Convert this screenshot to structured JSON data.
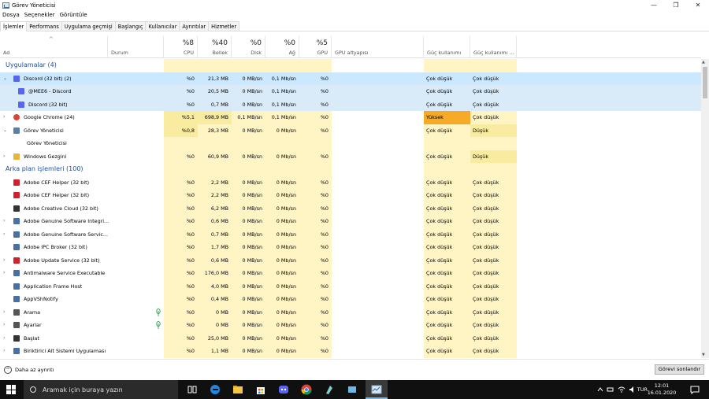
{
  "window": {
    "title": "Görev Yöneticisi",
    "buttons": {
      "minimize": "—",
      "maximize": "❐",
      "close": "✕"
    }
  },
  "menu": [
    "Dosya",
    "Seçenekler",
    "Görüntüle"
  ],
  "tabs": [
    "İşlemler",
    "Performans",
    "Uygulama geçmişi",
    "Başlangıç",
    "Kullanıcılar",
    "Ayrıntılar",
    "Hizmetler"
  ],
  "active_tab": 0,
  "columns": {
    "name": "Ad",
    "status": "Durum",
    "cpu": {
      "pct": "%8",
      "label": "CPU"
    },
    "memory": {
      "pct": "%40",
      "label": "Bellek"
    },
    "disk": {
      "pct": "%0",
      "label": "Disk"
    },
    "network": {
      "pct": "%0",
      "label": "Ağ"
    },
    "gpu": {
      "pct": "%5",
      "label": "GPU"
    },
    "gpu_engine": "GPU altyapısı",
    "power": "Güç kullanımı",
    "power_trend": "Güç kullanımı ..."
  },
  "rows": [
    {
      "type": "group",
      "title": "Uygulamalar (4)"
    },
    {
      "type": "proc",
      "expander": "⌄",
      "indent": 0,
      "icon": "discord-icon",
      "iconColor": "#5865f2",
      "name": "Discord (32 bit) (2)",
      "cpu": "%0",
      "mem": "21,3 MB",
      "disk": "0 MB/sn",
      "net": "0,1 Mb/sn",
      "gpu": "%0",
      "power": "Çok düşük",
      "trend": "Çok düşük",
      "sel": "selected"
    },
    {
      "type": "proc",
      "indent": 1,
      "icon": "discord-icon",
      "iconColor": "#5865f2",
      "name": "@MEE6 - Discord",
      "cpu": "%0",
      "mem": "20,5 MB",
      "disk": "0 MB/sn",
      "net": "0,1 Mb/sn",
      "gpu": "%0",
      "power": "Çok düşük",
      "trend": "Çok düşük",
      "sel": "selected-light"
    },
    {
      "type": "proc",
      "indent": 1,
      "icon": "discord-icon",
      "iconColor": "#5865f2",
      "name": "Discord (32 bit)",
      "cpu": "%0",
      "mem": "0,7 MB",
      "disk": "0 MB/sn",
      "net": "0,1 Mb/sn",
      "gpu": "%0",
      "power": "Çok düşük",
      "trend": "Çok düşük",
      "sel": "selected-light"
    },
    {
      "type": "proc",
      "expander": "›",
      "indent": 0,
      "icon": "chrome-icon",
      "iconColor": "#db4437",
      "name": "Google Chrome (24)",
      "cpu": "%5,1",
      "mem": "698,9 MB",
      "disk": "0,1 MB/sn",
      "net": "0,1 Mb/sn",
      "gpu": "%0",
      "power": "Yüksek",
      "trend": "Çok düşük",
      "cpuHi": true,
      "memHi": true,
      "powerHi": true
    },
    {
      "type": "proc",
      "expander": "⌄",
      "indent": 0,
      "icon": "task-manager-icon",
      "iconColor": "#5a7fa8",
      "name": "Görev Yöneticisi",
      "cpu": "%0,8",
      "mem": "28,3 MB",
      "disk": "0 MB/sn",
      "net": "0 Mb/sn",
      "gpu": "%0",
      "power": "Çok düşük",
      "trend": "Düşük",
      "cpuHi": true,
      "trendHi": true,
      "tall": true
    },
    {
      "type": "child",
      "name": "Görev Yöneticisi"
    },
    {
      "type": "proc",
      "expander": "›",
      "indent": 0,
      "icon": "folder-icon",
      "iconColor": "#e8b53a",
      "name": "Windows Gezgini",
      "cpu": "%0",
      "mem": "60,9 MB",
      "disk": "0 MB/sn",
      "net": "0 Mb/sn",
      "gpu": "%0",
      "power": "Çok düşük",
      "trend": "Düşük",
      "trendHi": true
    },
    {
      "type": "group",
      "title": "Arka plan işlemleri (100)"
    },
    {
      "type": "proc",
      "indent": 0,
      "icon": "adobe-icon",
      "iconColor": "#d4202a",
      "name": "Adobe CEF Helper (32 bit)",
      "cpu": "%0",
      "mem": "2,2 MB",
      "disk": "0 MB/sn",
      "net": "0 Mb/sn",
      "gpu": "%0",
      "power": "Çok düşük",
      "trend": "Çok düşük"
    },
    {
      "type": "proc",
      "indent": 0,
      "icon": "adobe-icon",
      "iconColor": "#d4202a",
      "name": "Adobe CEF Helper (32 bit)",
      "cpu": "%0",
      "mem": "2,2 MB",
      "disk": "0 MB/sn",
      "net": "0 Mb/sn",
      "gpu": "%0",
      "power": "Çok düşük",
      "trend": "Çok düşük"
    },
    {
      "type": "proc",
      "indent": 0,
      "icon": "creative-cloud-icon",
      "iconColor": "#333333",
      "name": "Adobe Creative Cloud (32 bit)",
      "cpu": "%0",
      "mem": "6,2 MB",
      "disk": "0 MB/sn",
      "net": "0 Mb/sn",
      "gpu": "%0",
      "power": "Çok düşük",
      "trend": "Çok düşük"
    },
    {
      "type": "proc",
      "expander": "›",
      "indent": 0,
      "icon": "service-icon",
      "iconColor": "#4a6fa5",
      "name": "Adobe Genuine Software Integri...",
      "cpu": "%0",
      "mem": "0,6 MB",
      "disk": "0 MB/sn",
      "net": "0 Mb/sn",
      "gpu": "%0",
      "power": "Çok düşük",
      "trend": "Çok düşük"
    },
    {
      "type": "proc",
      "expander": "›",
      "indent": 0,
      "icon": "service-icon",
      "iconColor": "#4a6fa5",
      "name": "Adobe Genuine Software Servic...",
      "cpu": "%0",
      "mem": "0,7 MB",
      "disk": "0 MB/sn",
      "net": "0 Mb/sn",
      "gpu": "%0",
      "power": "Çok düşük",
      "trend": "Çok düşük"
    },
    {
      "type": "proc",
      "indent": 0,
      "icon": "service-icon",
      "iconColor": "#4a6fa5",
      "name": "Adobe IPC Broker (32 bit)",
      "cpu": "%0",
      "mem": "1,7 MB",
      "disk": "0 MB/sn",
      "net": "0 Mb/sn",
      "gpu": "%0",
      "power": "Çok düşük",
      "trend": "Çok düşük"
    },
    {
      "type": "proc",
      "expander": "›",
      "indent": 0,
      "icon": "adobe-icon",
      "iconColor": "#d4202a",
      "name": "Adobe Update Service (32 bit)",
      "cpu": "%0",
      "mem": "0,6 MB",
      "disk": "0 MB/sn",
      "net": "0 Mb/sn",
      "gpu": "%0",
      "power": "Çok düşük",
      "trend": "Çok düşük"
    },
    {
      "type": "proc",
      "expander": "›",
      "indent": 0,
      "icon": "service-icon",
      "iconColor": "#4a6fa5",
      "name": "Antimalware Service Executable",
      "cpu": "%0",
      "mem": "176,0 MB",
      "disk": "0 MB/sn",
      "net": "0 Mb/sn",
      "gpu": "%0",
      "power": "Çok düşük",
      "trend": "Çok düşük"
    },
    {
      "type": "proc",
      "indent": 0,
      "icon": "service-icon",
      "iconColor": "#4a6fa5",
      "name": "Application Frame Host",
      "cpu": "%0",
      "mem": "4,0 MB",
      "disk": "0 MB/sn",
      "net": "0 Mb/sn",
      "gpu": "%0",
      "power": "Çok düşük",
      "trend": "Çok düşük"
    },
    {
      "type": "proc",
      "indent": 0,
      "icon": "service-icon",
      "iconColor": "#4a6fa5",
      "name": "AppVShNotify",
      "cpu": "%0",
      "mem": "0,4 MB",
      "disk": "0 MB/sn",
      "net": "0 Mb/sn",
      "gpu": "%0",
      "power": "Çok düşük",
      "trend": "Çok düşük"
    },
    {
      "type": "proc",
      "expander": "›",
      "indent": 0,
      "icon": "search-app-icon",
      "iconColor": "#555555",
      "name": "Arama",
      "cpu": "%0",
      "mem": "0 MB",
      "disk": "0 MB/sn",
      "net": "0 Mb/sn",
      "gpu": "%0",
      "power": "Çok düşük",
      "trend": "Çok düşük",
      "leaf": true
    },
    {
      "type": "proc",
      "expander": "›",
      "indent": 0,
      "icon": "settings-icon",
      "iconColor": "#555555",
      "name": "Ayarlar",
      "cpu": "%0",
      "mem": "0 MB",
      "disk": "0 MB/sn",
      "net": "0 Mb/sn",
      "gpu": "%0",
      "power": "Çok düşük",
      "trend": "Çok düşük",
      "leaf": true
    },
    {
      "type": "proc",
      "expander": "›",
      "indent": 0,
      "icon": "start-app-icon",
      "iconColor": "#333333",
      "name": "Başlat",
      "cpu": "%0",
      "mem": "25,0 MB",
      "disk": "0 MB/sn",
      "net": "0 Mb/sn",
      "gpu": "%0",
      "power": "Çok düşük",
      "trend": "Çok düşük"
    },
    {
      "type": "proc",
      "expander": "›",
      "indent": 0,
      "icon": "service-icon",
      "iconColor": "#4a6fa5",
      "name": "Biriktirici Alt Sistemi Uygulaması",
      "cpu": "%0",
      "mem": "1,1 MB",
      "disk": "0 MB/sn",
      "net": "0 Mb/sn",
      "gpu": "%0",
      "power": "Çok düşük",
      "trend": "Çok düşük"
    }
  ],
  "footer": {
    "fewer_details": "Daha az ayrıntı",
    "end_task": "Görevi sonlandır"
  },
  "taskbar": {
    "search_placeholder": "Aramak için buraya yazın",
    "language": "TUR",
    "time": "12:01",
    "date": "16.01.2020"
  },
  "colors": {
    "cpu_bg": "#fff4c4",
    "cpu_hi": "#f9eca0",
    "power_high": "#f7a928",
    "selected": "#cce8ff",
    "group_title": "#1f4e9e"
  }
}
